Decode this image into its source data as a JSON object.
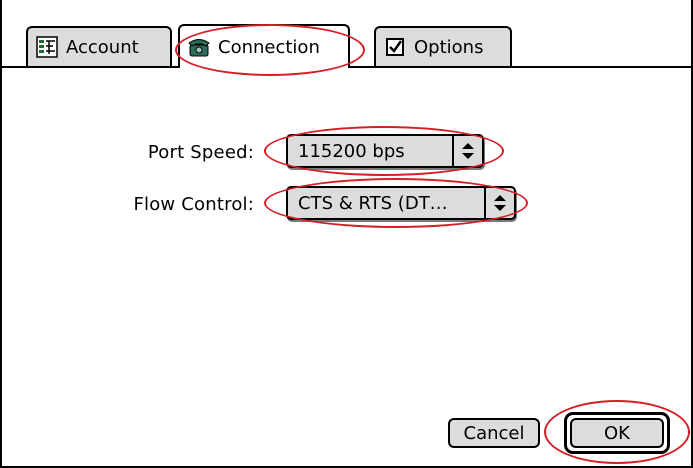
{
  "tabs": [
    {
      "label": "Account",
      "icon": "account-icon"
    },
    {
      "label": "Connection",
      "icon": "phone-icon"
    },
    {
      "label": "Options",
      "icon": "checkbox-icon"
    }
  ],
  "fields": {
    "port_speed_label": "Port Speed:",
    "port_speed_value": "115200 bps",
    "flow_control_label": "Flow Control:",
    "flow_control_value": "CTS & RTS (DT…"
  },
  "buttons": {
    "cancel": "Cancel",
    "ok": "OK"
  },
  "colors": {
    "highlight_ellipse": "#d41f26",
    "control_fill": "#dcdcdc"
  }
}
